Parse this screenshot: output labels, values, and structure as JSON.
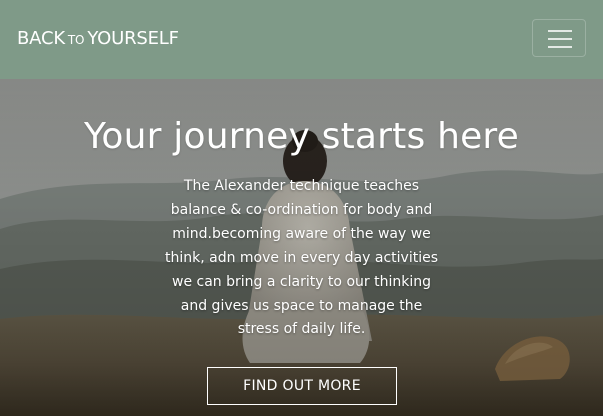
{
  "navbar": {
    "brand_main": "BACK",
    "brand_small": "TO",
    "brand_end": "YOURSELF",
    "background_color": "#7f9a88",
    "menu_toggle_icon": "hamburger-menu-icon"
  },
  "hero": {
    "title": "Your journey starts here",
    "text": "The Alexander technique teaches balance & co-ordination for body and mind.becoming aware of the way we think, adn move in every day activities we can bring a clarity to our thinking and gives us space to manage the stress of daily life.",
    "cta_label": "FIND OUT MORE"
  }
}
